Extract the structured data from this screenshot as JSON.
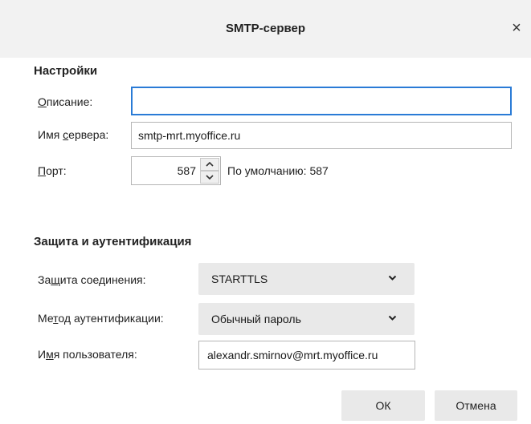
{
  "dialog": {
    "title": "SMTP-сервер",
    "close_glyph": "×",
    "close_icon": "close-icon"
  },
  "settings": {
    "section_title": "Настройки",
    "description_label_underlined": "О",
    "description_label_rest": "писание:",
    "description_value": "",
    "server_label_start": "Имя ",
    "server_label_underlined": "с",
    "server_label_rest": "ервера:",
    "server_value": "smtp-mrt.myoffice.ru",
    "port_label_underlined": "П",
    "port_label_rest": "орт:",
    "port_value": "587",
    "default_text": "По умолчанию:  587",
    "spin_up_icon": "chevron-up-icon",
    "spin_down_icon": "chevron-down-icon"
  },
  "security": {
    "section_title": "Защита и аутентификация",
    "connection_label_start": "За",
    "connection_label_underlined": "щ",
    "connection_label_rest": "ита соединения:",
    "connection_value": "STARTTLS",
    "auth_label_start": "Ме",
    "auth_label_underlined": "т",
    "auth_label_rest": "од аутентификации:",
    "auth_value": "Обычный пароль",
    "username_label_start": "И",
    "username_label_underlined": "м",
    "username_label_rest": "я пользователя:",
    "username_value": "alexandr.smirnov@mrt.myoffice.ru"
  },
  "buttons": {
    "ok_label": "ОК",
    "cancel_label": "Отмена"
  },
  "colors": {
    "focus_accent": "#2a7bd6",
    "titlebar_bg": "#f2f2f2",
    "button_bg": "#e9e9e9"
  }
}
